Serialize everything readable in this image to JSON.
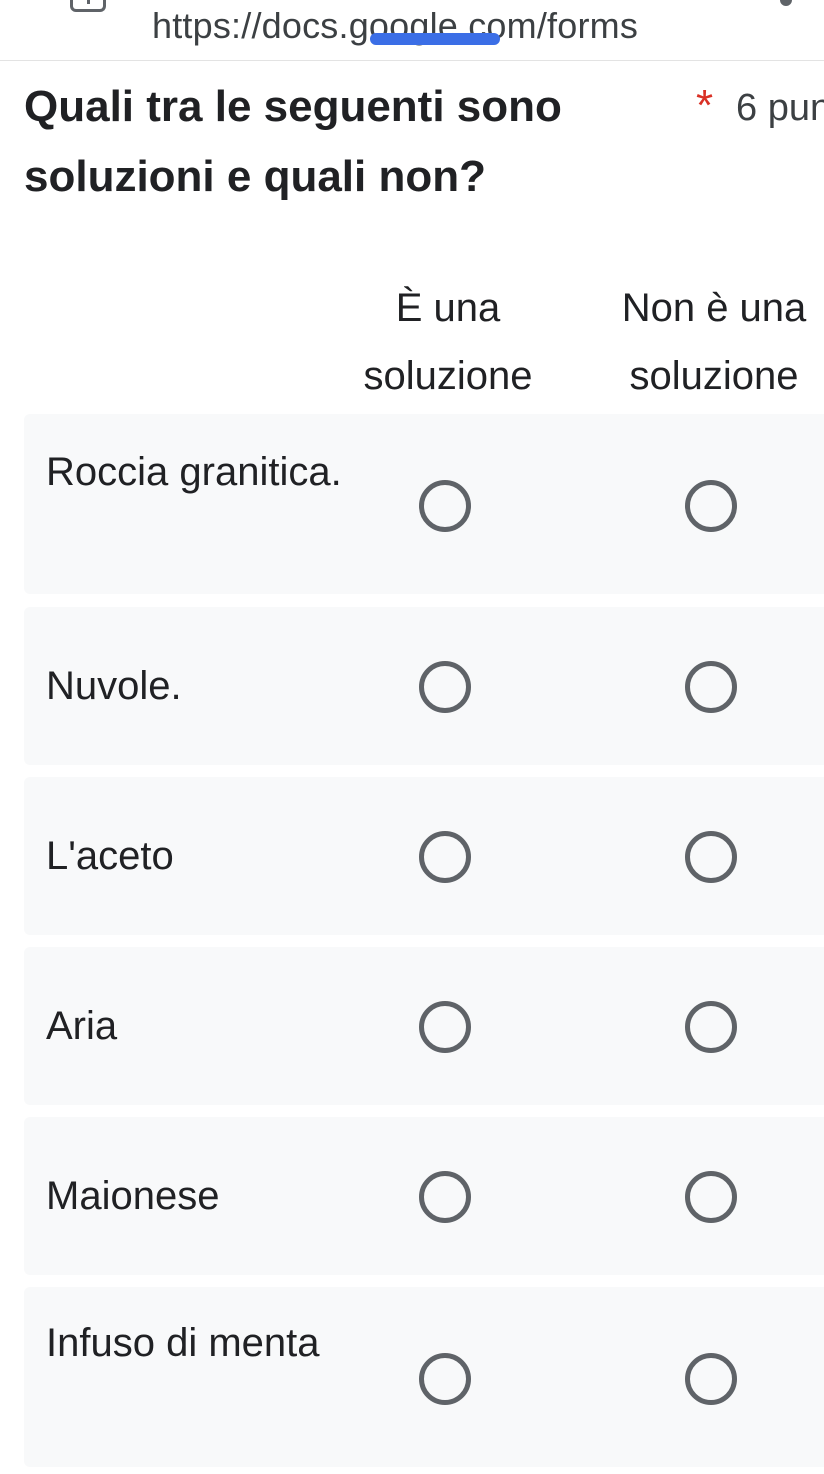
{
  "browser": {
    "url": "https://docs.google.com/forms"
  },
  "question": {
    "title": "Quali tra le seguenti sono soluzioni e quali non?",
    "required_marker": "*",
    "points": "6 pun"
  },
  "columns": [
    "È una soluzione",
    "Non è una soluzione"
  ],
  "rows": [
    {
      "label": "Roccia granitica."
    },
    {
      "label": "Nuvole."
    },
    {
      "label": "L'aceto"
    },
    {
      "label": "Aria"
    },
    {
      "label": "Maionese"
    },
    {
      "label": "Infuso di menta"
    }
  ],
  "colors": {
    "required": "#d93025",
    "row_background": "#f8f9fa",
    "radio_border": "#5f6368",
    "redaction": "#3b6ee6"
  }
}
